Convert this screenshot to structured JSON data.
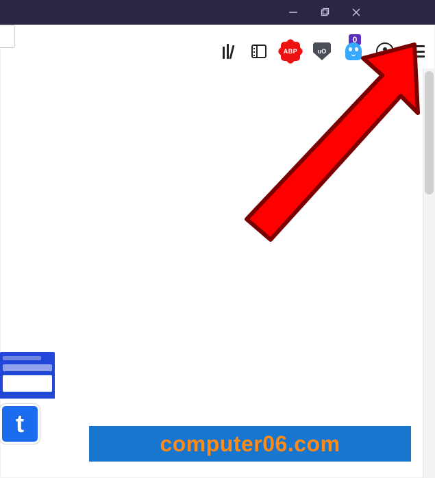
{
  "window": {
    "controls": {
      "minimize": "minimize",
      "maximize": "maximize",
      "close": "close"
    }
  },
  "toolbar": {
    "library": {
      "name": "library-icon"
    },
    "sidebar": {
      "name": "sidebar-icon"
    },
    "abp": {
      "label": "ABP"
    },
    "ublock": {
      "label": "uO"
    },
    "ghostery": {
      "badge": "0"
    },
    "account": {
      "name": "account-icon"
    },
    "menu": {
      "name": "hamburger-menu-icon"
    }
  },
  "annotation": {
    "arrow": {
      "color": "#ff0000",
      "target": "hamburger-menu"
    }
  },
  "thumbnail": {
    "tile_letter": "t"
  },
  "watermark": {
    "text": "computer06.com",
    "bg": "#1876cf",
    "fg": "#ff8a15"
  }
}
